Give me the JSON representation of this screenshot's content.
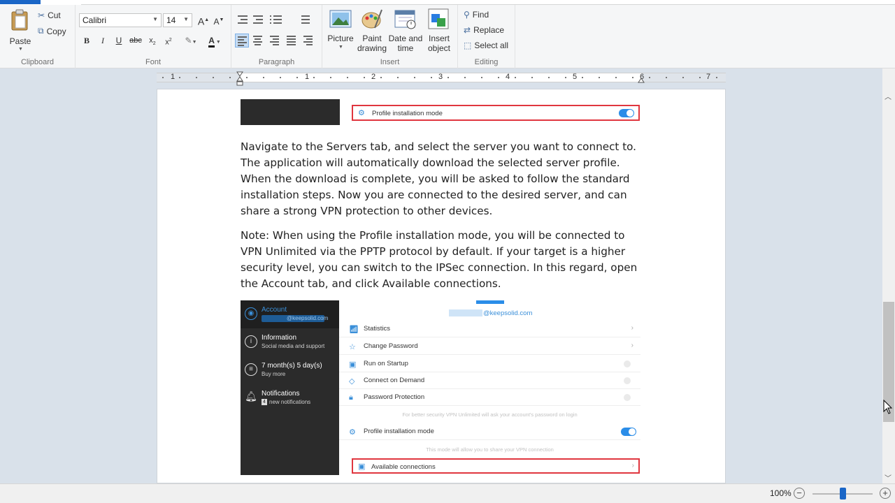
{
  "clipboard": {
    "label": "Clipboard",
    "paste": "Paste",
    "cut": "Cut",
    "copy": "Copy"
  },
  "font": {
    "label": "Font",
    "family": "Calibri",
    "size": "14"
  },
  "paragraph": {
    "label": "Paragraph"
  },
  "insert": {
    "label": "Insert",
    "picture": "Picture",
    "paint_line1": "Paint",
    "paint_line2": "drawing",
    "datetime_line1": "Date and",
    "datetime_line2": "time",
    "object_line1": "Insert",
    "object_line2": "object"
  },
  "editing": {
    "label": "Editing",
    "find": "Find",
    "replace": "Replace",
    "select_all": "Select all"
  },
  "ruler": {
    "numbers": [
      "1",
      "1",
      "2",
      "3",
      "4",
      "5",
      "6",
      "7"
    ]
  },
  "document": {
    "para1": "Navigate to the Servers tab, and select the server you want to connect to. The application will automatically download the selected server profile. When the download is complete, you will be asked to follow the standard installation steps. Now you are connected to the desired server, and can share a strong VPN protection to other devices.",
    "para2": "Note: When using the Profile installation mode, you will be connected to VPN Unlimited via the PPTP protocol by default. If your target is a higher security level, you can switch to the IPSec connection. In this regard, open the Account tab, and click Available connections.",
    "shot1": {
      "row": "Profile installation mode"
    },
    "shot2": {
      "side": [
        {
          "title": "Account",
          "sub": "@keepsolid.com"
        },
        {
          "title": "Information",
          "sub": "Social media and support"
        },
        {
          "title": "7 month(s) 5 day(s)",
          "sub": "Buy more"
        },
        {
          "title": "Notifications",
          "sub": "new notifications",
          "badge": "4"
        }
      ],
      "email": "@keepsolid.com",
      "rows": [
        "Statistics",
        "Change Password",
        "Run on Startup",
        "Connect on Demand",
        "Password Protection"
      ],
      "password_note": "For better security VPN Unlimited will ask your account's password on login",
      "profile_row": "Profile installation mode",
      "profile_note": "This mode will allow you to share your VPN connection",
      "available_row": "Available connections"
    }
  },
  "status": {
    "zoom": "100%"
  }
}
